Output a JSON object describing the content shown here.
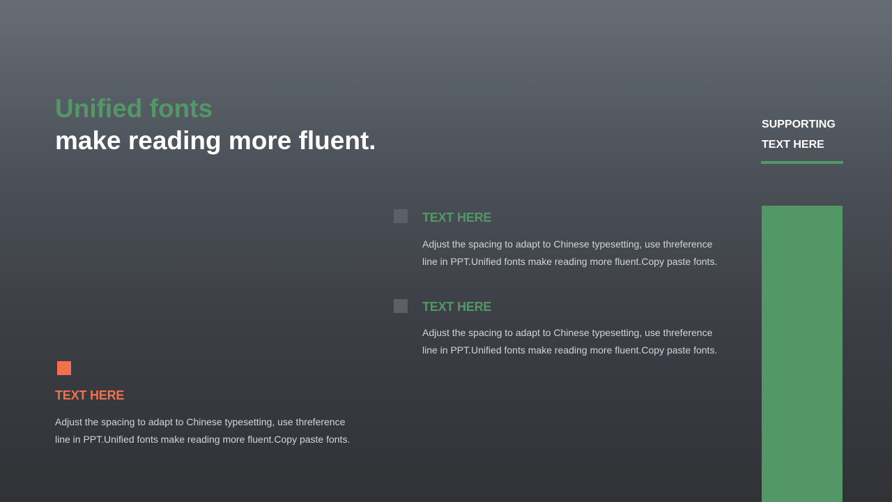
{
  "colors": {
    "green": "#549766",
    "orange": "#f2714a",
    "gray_square": "#5b5f66",
    "white": "#ffffff"
  },
  "title": {
    "line1": "Unified fonts",
    "line2": "make reading more fluent."
  },
  "supporting": {
    "line1": "SUPPORTING",
    "line2": "TEXT HERE"
  },
  "items": [
    {
      "heading": "TEXT HERE",
      "body_line1": "Adjust the spacing to adapt to Chinese typesetting, use threference",
      "body_line2": "line in PPT.Unified fonts make reading more fluent.Copy paste fonts."
    },
    {
      "heading": "TEXT HERE",
      "body_line1": "Adjust the spacing to adapt to Chinese typesetting, use threference",
      "body_line2": "line in PPT.Unified fonts make reading more fluent.Copy paste fonts."
    },
    {
      "heading": "TEXT HERE",
      "body_line1": "Adjust the spacing to adapt to Chinese typesetting, use threference",
      "body_line2": "line in PPT.Unified fonts make reading more fluent.Copy paste fonts."
    }
  ]
}
